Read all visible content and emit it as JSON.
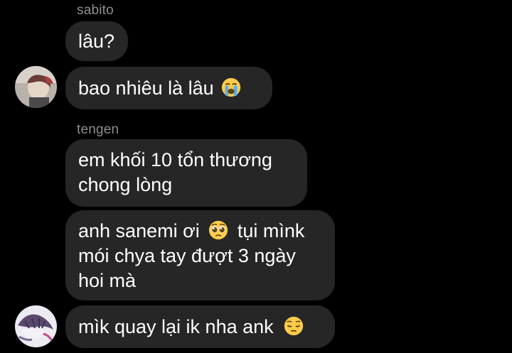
{
  "chat": {
    "group1": {
      "sender": "sabito",
      "messages": [
        {
          "text": "lâu?"
        },
        {
          "text": "bao nhiêu là lâu",
          "emoji": "loudly-crying-face-icon"
        }
      ]
    },
    "group2": {
      "sender": "tengen",
      "messages": [
        {
          "line1": "em khối 10 tổn thương",
          "line2": "chong lòng"
        },
        {
          "line1_prefix": "anh sanemi ơi",
          "line1_emoji": "pleading-face-icon",
          "line1_suffix": "tụi mìnk",
          "line2": "mói chya tay đượt 3 ngày",
          "line3": "hoi mà"
        },
        {
          "text": "mìk quay lại ik nha ank",
          "emoji": "pensive-face-icon"
        }
      ]
    }
  },
  "colors": {
    "background": "#000000",
    "bubble": "#262626",
    "sender_name": "#8e8e93",
    "text": "#ffffff"
  }
}
